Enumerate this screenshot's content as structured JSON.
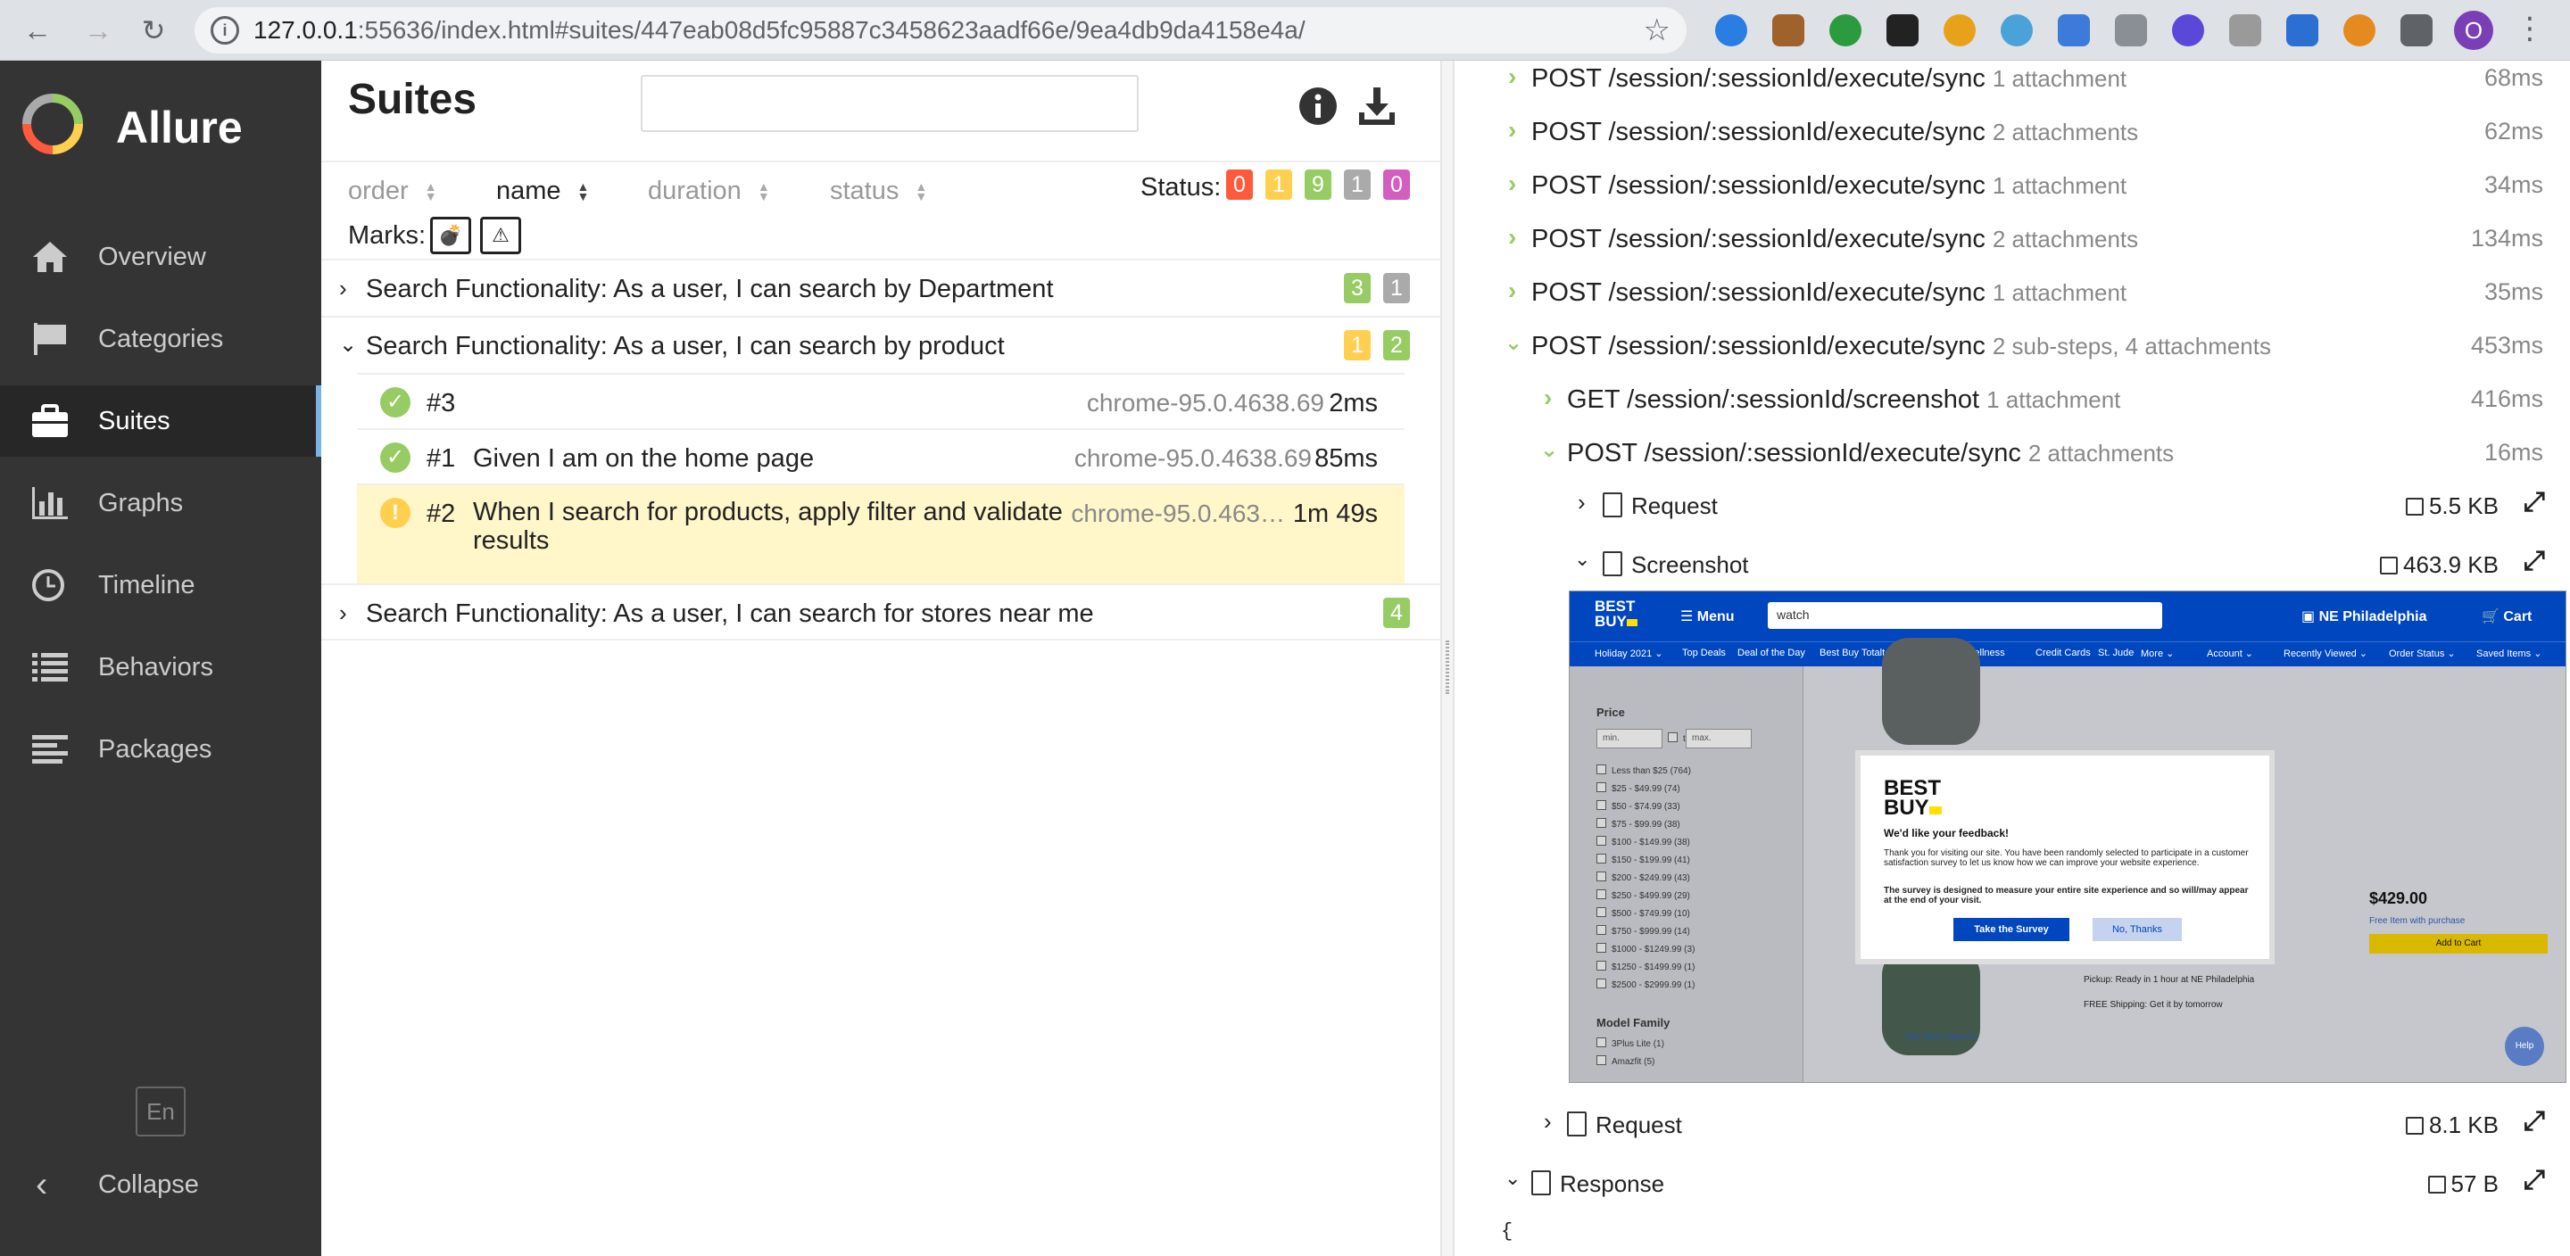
{
  "browser": {
    "url_host": "127.0.0.1",
    "url_rest": ":55636/index.html#suites/447eab08d5fc95887c3458623aadf66e/9ea4db9da4158e4a/",
    "profile_initial": "O"
  },
  "sidebar": {
    "brand": "Allure",
    "items": [
      {
        "label": "Overview",
        "icon": "home-icon"
      },
      {
        "label": "Categories",
        "icon": "flag-icon"
      },
      {
        "label": "Suites",
        "icon": "briefcase-icon"
      },
      {
        "label": "Graphs",
        "icon": "bar-chart-icon"
      },
      {
        "label": "Timeline",
        "icon": "clock-icon"
      },
      {
        "label": "Behaviors",
        "icon": "list-icon"
      },
      {
        "label": "Packages",
        "icon": "align-left-icon"
      }
    ],
    "active": "Suites",
    "lang": "En",
    "collapse": "Collapse"
  },
  "suites": {
    "title": "Suites",
    "search_value": "",
    "sort": {
      "order": "order",
      "name": "name",
      "duration": "duration",
      "status": "status"
    },
    "status_label": "Status:",
    "status_counts": {
      "failed": "0",
      "broken": "1",
      "passed": "9",
      "skipped": "1",
      "unknown": "0"
    },
    "marks_label": "Marks:",
    "groups": [
      {
        "title": "Search Functionality: As a user, I can search by Department",
        "badges": [
          "3",
          "1"
        ]
      },
      {
        "title": "Search Functionality: As a user, I can search by product",
        "badges": [
          "1",
          "2"
        ]
      },
      {
        "title": "Search Functionality: As a user, I can search for stores near me",
        "badges": [
          "4"
        ]
      }
    ],
    "tests": [
      {
        "num": "#3",
        "name": "",
        "env": "chrome-95.0.4638.69",
        "dur": "2ms"
      },
      {
        "num": "#1",
        "name": "Given I am on the home page",
        "env": "chrome-95.0.4638.69",
        "dur": "85ms"
      },
      {
        "num": "#2",
        "name_line1": "When I search for products, apply filter and validate",
        "name_line2": "results",
        "env": "chrome-95.0.463…",
        "dur": "1m 49s"
      }
    ]
  },
  "steps": {
    "top": [
      {
        "text": "POST /session/:sessionId/execute/sync",
        "meta": "1 attachment",
        "time": "68ms"
      },
      {
        "text": "POST /session/:sessionId/execute/sync",
        "meta": "2 attachments",
        "time": "62ms"
      },
      {
        "text": "POST /session/:sessionId/execute/sync",
        "meta": "1 attachment",
        "time": "34ms"
      },
      {
        "text": "POST /session/:sessionId/execute/sync",
        "meta": "2 attachments",
        "time": "134ms"
      },
      {
        "text": "POST /session/:sessionId/execute/sync",
        "meta": "1 attachment",
        "time": "35ms"
      },
      {
        "text": "POST /session/:sessionId/execute/sync",
        "meta": "2 sub-steps, 4 attachments",
        "time": "453ms"
      }
    ],
    "sub": [
      {
        "text": "GET /session/:sessionId/screenshot",
        "meta": "1 attachment",
        "time": "416ms"
      },
      {
        "text": "POST /session/:sessionId/execute/sync",
        "meta": "2 attachments",
        "time": "16ms"
      }
    ],
    "attachments": {
      "request1": {
        "label": "Request",
        "size": "5.5 KB"
      },
      "screenshot": {
        "label": "Screenshot",
        "size": "463.9 KB"
      },
      "request2": {
        "label": "Request",
        "size": "8.1 KB"
      },
      "response": {
        "label": "Response",
        "size": "57 B"
      }
    },
    "response_body": "{"
  },
  "screenshot": {
    "logo_line1": "BEST",
    "logo_line2": "BUY",
    "menu": "Menu",
    "search": "watch",
    "store": "NE Philadelphia",
    "cart": "Cart",
    "subnav": [
      "Holiday 2021 ⌄",
      "Top Deals",
      "Deal of the Day",
      "Best Buy Totaltech",
      "Health & Wellness",
      "Credit Cards",
      "St. Jude",
      "More ⌄",
      "Account ⌄",
      "Recently Viewed ⌄",
      "Order Status ⌄",
      "Saved Items ⌄"
    ],
    "price_heading": "Price",
    "min": "min.",
    "max": "max.",
    "to": "to",
    "price_options": [
      "Less than $25 (764)",
      "$25 - $49.99 (74)",
      "$50 - $74.99 (33)",
      "$75 - $99.99 (38)",
      "$100 - $149.99 (38)",
      "$150 - $199.99 (41)",
      "$200 - $249.99 (43)",
      "$250 - $499.99 (29)",
      "$500 - $749.99 (10)",
      "$750 - $999.99 (14)",
      "$1000 - $1249.99 (3)",
      "$1250 - $1499.99 (1)",
      "$2500 - $2999.99 (1)"
    ],
    "model_heading": "Model Family",
    "model_options": [
      "3Plus Lite (1)",
      "Amazfit (5)"
    ],
    "price": "$429.00",
    "free_item": "Free Item with purchase",
    "add_to_cart": "Add to Cart",
    "modal_title": "We'd like your feedback!",
    "modal_p1": "Thank you for visiting our site. You have been randomly selected to participate in a customer satisfaction survey to let us know how we can improve your website experience.",
    "modal_p2": "The survey is designed to measure your entire site experience and so will/may appear at the end of your visit.",
    "take_survey": "Take the Survey",
    "no_thanks": "No, Thanks",
    "pickup": "Pickup: Ready in 1 hour at NE Philadelphia",
    "shipping": "FREE Shipping: Get it by tomorrow",
    "see_more": "See More Options",
    "help": "Help"
  },
  "colors": {
    "failed": "#fd5a3e",
    "broken": "#ffd050",
    "passed": "#97cc64",
    "skipped": "#aaaaaa",
    "unknown": "#d35ebe",
    "sidebar": "#343434",
    "accent": "#7ab3e6"
  }
}
